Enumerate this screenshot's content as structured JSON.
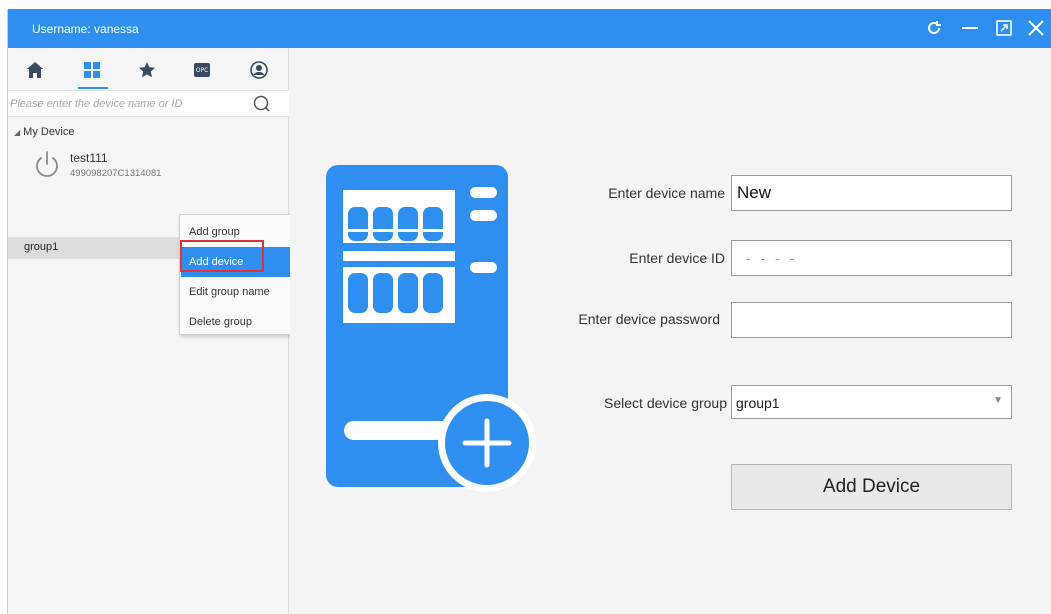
{
  "titlebar": {
    "username_text": "Username: vanessa",
    "bg_color": "#2f8ff0",
    "buttons": [
      "refresh-icon",
      "minimize-icon",
      "restore-icon",
      "close-icon"
    ]
  },
  "sidebar": {
    "nav_icons": [
      "home-icon",
      "grid-icon",
      "star-icon",
      "opc-icon",
      "user-icon"
    ],
    "active_nav": "grid-icon",
    "search": {
      "placeholder": "Please enter the device name or ID",
      "value": ""
    },
    "tree": {
      "root_label": "My Device",
      "device": {
        "name": "test111",
        "id": "499098207C1314081"
      },
      "group": {
        "name": "group1"
      }
    },
    "context_menu": {
      "items": [
        {
          "label": "Add group"
        },
        {
          "label": "Add device"
        },
        {
          "label": "Edit group name"
        },
        {
          "label": "Delete group"
        }
      ],
      "active_index": 1
    }
  },
  "form": {
    "device_name_label": "Enter device name",
    "device_name_value": "New",
    "device_id_label": "Enter device ID",
    "device_id_placeholder": "- - - -",
    "device_password_label": "Enter device password",
    "device_password_value": "",
    "group_label": "Select device group",
    "group_value": "group1",
    "submit_label": "Add Device"
  },
  "colors": {
    "accent": "#2f8ff0",
    "highlight_box": "#e0303a"
  }
}
